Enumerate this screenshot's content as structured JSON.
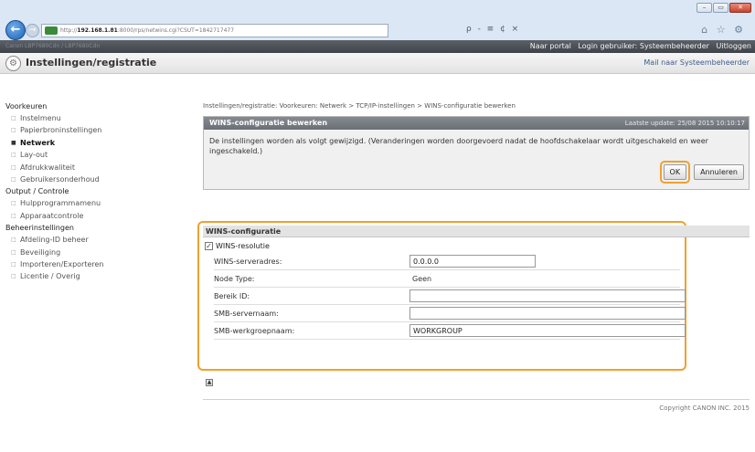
{
  "browser": {
    "url_prefix": "http://",
    "url_host": "192.168.1.81",
    "url_rest": ":8000/rps/netwins.cgi?CSUT=1842717477",
    "tools": "ρ - ≡ ¢ ×",
    "icons": "⌂ ☆ ⚙"
  },
  "appbar": {
    "dim_text": "Canon LBP7680Cdn / LBP7680Cdn",
    "portal_link": "Naar portal",
    "login_label": "Login gebruiker: Systeembeheerder",
    "logout_link": "Uitloggen"
  },
  "titlebar": {
    "title": "Instellingen/registratie",
    "mail_link": "Mail naar Systeembeheerder"
  },
  "sidebar": {
    "groups": [
      {
        "heading": "Voorkeuren",
        "items": [
          "Instelmenu",
          "Papierbroninstellingen",
          "Netwerk",
          "Lay-out",
          "Afdrukkwaliteit",
          "Gebruikersonderhoud"
        ]
      },
      {
        "heading": "Output / Controle",
        "items": [
          "Hulpprogrammamenu",
          "Apparaatcontrole"
        ]
      },
      {
        "heading": "Beheerinstellingen",
        "items": [
          "Afdeling-ID beheer",
          "Beveiliging",
          "Importeren/Exporteren",
          "Licentie / Overig"
        ]
      }
    ],
    "active_item": "Netwerk"
  },
  "main": {
    "breadcrumb": "Instellingen/registratie: Voorkeuren: Netwerk > TCP/IP-instellingen > WINS-configuratie bewerken",
    "panel_title": "WINS-configuratie bewerken",
    "last_update": "Laatste update: 25/08 2015 10:10:17",
    "description": "De instellingen worden als volgt gewijzigd. (Veranderingen worden doorgevoerd nadat de hoofdschakelaar wordt uitgeschakeld en weer ingeschakeld.)",
    "ok_label": "OK",
    "cancel_label": "Annuleren"
  },
  "wins": {
    "section_title": "WINS-configuratie",
    "resolution_label": "WINS-resolutie",
    "resolution_checked": true,
    "server_label": "WINS-serveradres:",
    "server_value": "0.0.0.0",
    "node_type_label": "Node Type:",
    "node_type_value": "Geen",
    "scope_id_label": "Bereik ID:",
    "scope_id_value": "",
    "smb_server_label": "SMB-servernaam:",
    "smb_server_value": "",
    "smb_group_label": "SMB-werkgroepnaam:",
    "smb_group_value": "WORKGROUP"
  },
  "footer": {
    "copyright": "Copyright CANON INC. 2015"
  }
}
